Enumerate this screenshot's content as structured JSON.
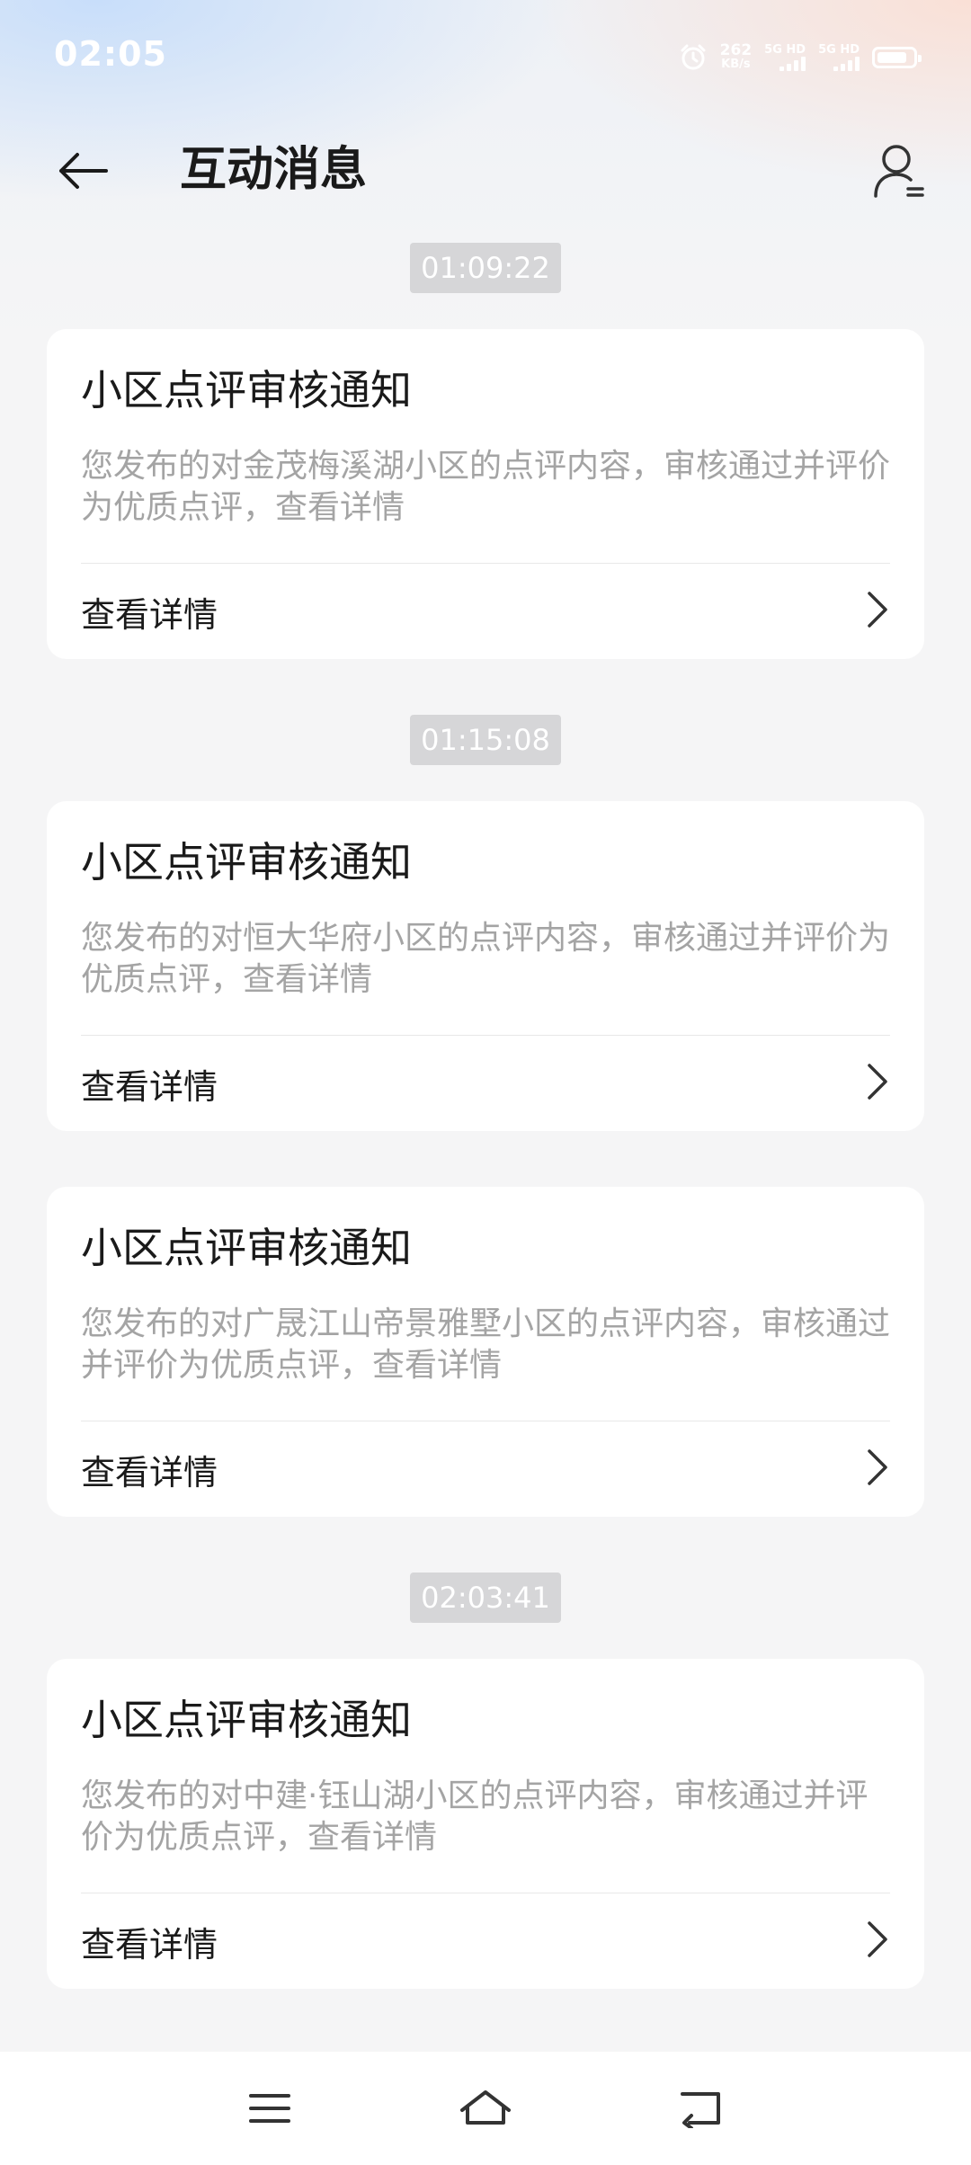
{
  "status_bar": {
    "time": "02:05",
    "net_speed": "262",
    "net_speed_unit": "KB/s",
    "sim1_label": "5G HD",
    "sim2_label": "5G HD",
    "battery_level": 0.85
  },
  "header": {
    "title": "互动消息"
  },
  "feed": {
    "groups": [
      {
        "time": "01:09:22",
        "cards": [
          {
            "title": "小区点评审核通知",
            "body": "您发布的对金茂梅溪湖小区的点评内容，审核通过并评价为优质点评，查看详情",
            "action": "查看详情"
          }
        ]
      },
      {
        "time": "01:15:08",
        "cards": [
          {
            "title": "小区点评审核通知",
            "body": "您发布的对恒大华府小区的点评内容，审核通过并评价为优质点评，查看详情",
            "action": "查看详情"
          },
          {
            "title": "小区点评审核通知",
            "body": "您发布的对广晟江山帝景雅墅小区的点评内容，审核通过并评价为优质点评，查看详情",
            "action": "查看详情"
          }
        ]
      },
      {
        "time": "02:03:41",
        "cards": [
          {
            "title": "小区点评审核通知",
            "body": "您发布的对中建·钰山湖小区的点评内容，审核通过并评价为优质点评，查看详情",
            "action": "查看详情"
          }
        ]
      }
    ]
  },
  "icons": {
    "back": "arrow-left-icon",
    "profile": "user-icon",
    "chevron": "chevron-right-icon",
    "nav_menu": "menu-icon",
    "nav_home": "home-icon",
    "nav_back": "back-icon"
  }
}
